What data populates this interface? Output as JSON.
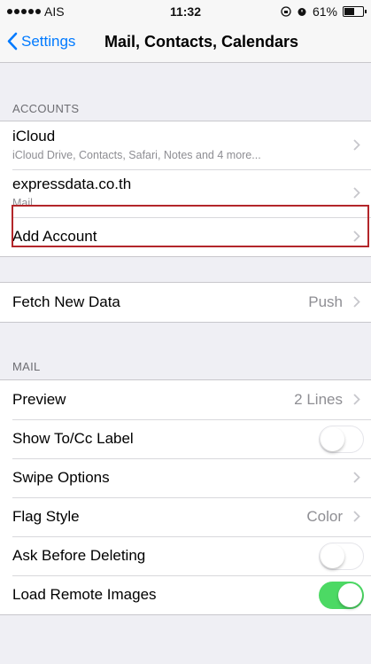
{
  "status_bar": {
    "carrier": "AIS",
    "time": "11:32",
    "battery": "61%",
    "battery_level": 0.61
  },
  "nav": {
    "back_label": "Settings",
    "title": "Mail, Contacts, Calendars"
  },
  "accounts": {
    "header": "ACCOUNTS",
    "items": [
      {
        "label": "iCloud",
        "sub": "iCloud Drive, Contacts, Safari, Notes and 4 more..."
      },
      {
        "label": "expressdata.co.th",
        "sub": "Mail"
      },
      {
        "label": "Add Account"
      }
    ]
  },
  "fetch": {
    "label": "Fetch New Data",
    "value": "Push"
  },
  "mail": {
    "header": "MAIL",
    "items": [
      {
        "label": "Preview",
        "value": "2 Lines"
      },
      {
        "label": "Show To/Cc Label",
        "toggle": "off"
      },
      {
        "label": "Swipe Options"
      },
      {
        "label": "Flag Style",
        "value": "Color"
      },
      {
        "label": "Ask Before Deleting",
        "toggle": "off"
      },
      {
        "label": "Load Remote Images",
        "toggle": "on"
      }
    ]
  },
  "colors": {
    "accent": "#007aff",
    "toggle_on": "#4cd964",
    "highlight": "#b3262a"
  },
  "icons": {
    "back": "chevron-left-icon",
    "disclosure": "chevron-right-icon",
    "alarm": "alarm-icon",
    "lock": "rotation-lock-icon",
    "battery": "battery-icon",
    "signal": "signal-dots-icon"
  }
}
